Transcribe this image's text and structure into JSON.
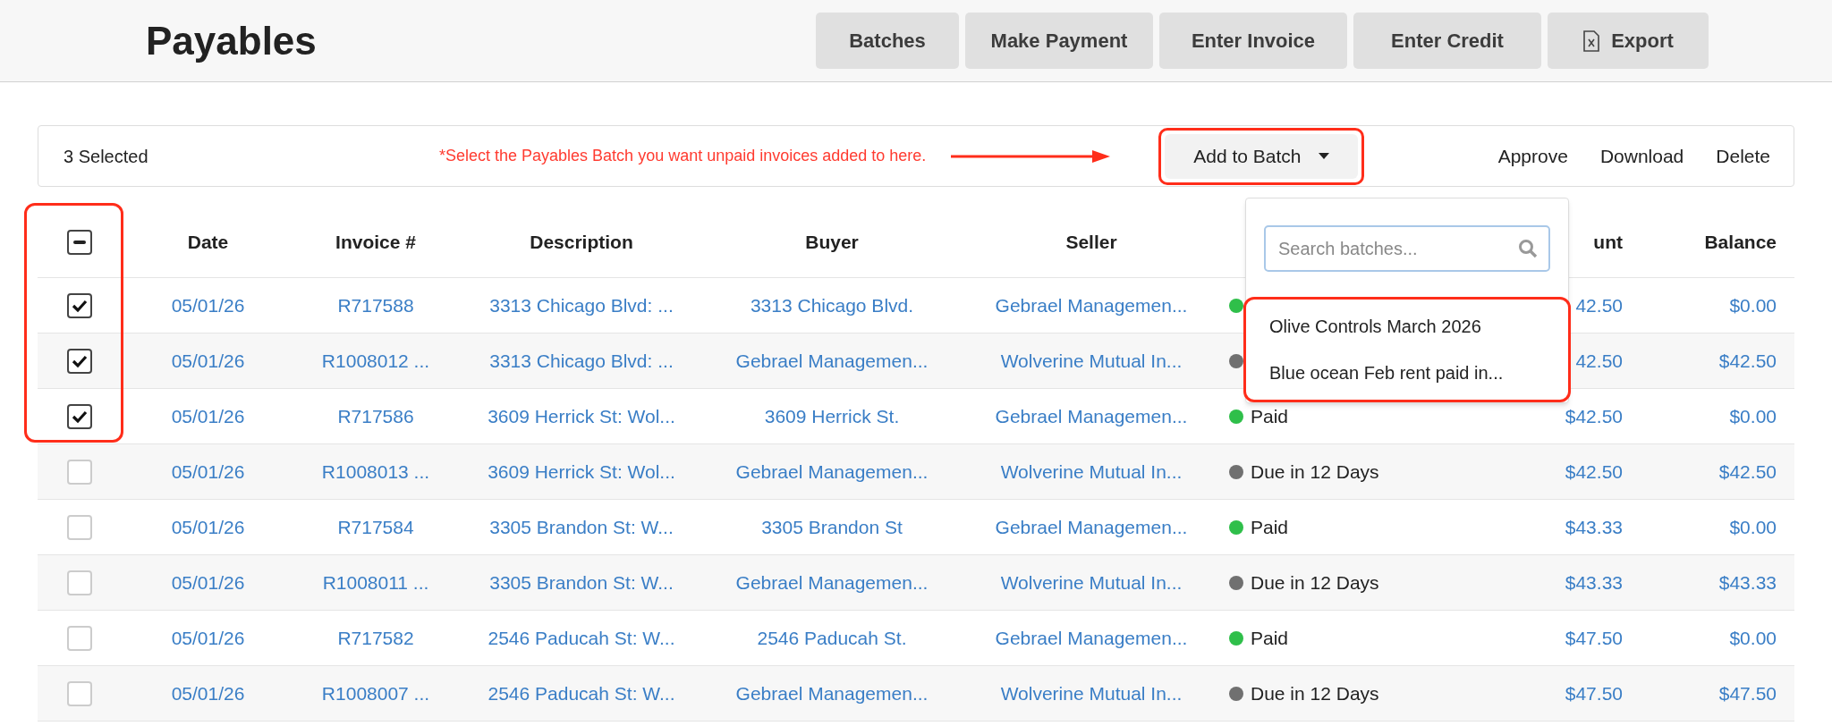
{
  "page_title": "Payables",
  "header_buttons": [
    {
      "label": "Batches",
      "kind": "plain"
    },
    {
      "label": "Make Payment",
      "kind": "plain"
    },
    {
      "label": "Enter Invoice",
      "kind": "plain"
    },
    {
      "label": "Enter Credit",
      "kind": "plain"
    },
    {
      "label": "Export",
      "kind": "file"
    }
  ],
  "toolbar": {
    "selected_count": "3 Selected",
    "note": "*Select the Payables Batch you want unpaid invoices added to here.",
    "batch_button": "Add to Batch",
    "actions": [
      "Approve",
      "Download",
      "Delete"
    ]
  },
  "batch_dropdown": {
    "placeholder": "Search batches...",
    "items": [
      "Olive Controls March 2026",
      "Blue ocean Feb rent paid in..."
    ]
  },
  "table": {
    "select_all": {
      "indeterminate": true
    },
    "columns": [
      "Date",
      "Invoice #",
      "Description",
      "Buyer",
      "Seller",
      "unt",
      "Balance"
    ],
    "rows": [
      {
        "checked": true,
        "date": "05/01/26",
        "invoice": "R717588",
        "description": "3313 Chicago Blvd: ...",
        "buyer": "3313 Chicago Blvd.",
        "seller": "Gebrael Managemen...",
        "color": "#2fbf4a",
        "amount": "42.50",
        "balance": "$0.00"
      },
      {
        "checked": true,
        "date": "05/01/26",
        "invoice": "R1008012 ...",
        "description": "3313 Chicago Blvd: ...",
        "buyer": "Gebrael Managemen...",
        "seller": "Wolverine Mutual In...",
        "color": "#707070",
        "amount": "42.50",
        "balance": "$42.50"
      },
      {
        "checked": true,
        "date": "05/01/26",
        "invoice": "R717586",
        "description": "3609 Herrick St: Wol...",
        "buyer": "3609 Herrick St.",
        "seller": "Gebrael Managemen...",
        "status": "Paid",
        "color": "#2fbf4a",
        "amount": "$42.50",
        "balance": "$0.00"
      },
      {
        "checked": false,
        "date": "05/01/26",
        "invoice": "R1008013 ...",
        "description": "3609 Herrick St: Wol...",
        "buyer": "Gebrael Managemen...",
        "seller": "Wolverine Mutual In...",
        "status": "Due in 12 Days",
        "color": "#707070",
        "amount": "$42.50",
        "balance": "$42.50"
      },
      {
        "checked": false,
        "date": "05/01/26",
        "invoice": "R717584",
        "description": "3305 Brandon St: W...",
        "buyer": "3305 Brandon St",
        "seller": "Gebrael Managemen...",
        "status": "Paid",
        "color": "#2fbf4a",
        "amount": "$43.33",
        "balance": "$0.00"
      },
      {
        "checked": false,
        "date": "05/01/26",
        "invoice": "R1008011 ...",
        "description": "3305 Brandon St: W...",
        "buyer": "Gebrael Managemen...",
        "seller": "Wolverine Mutual In...",
        "status": "Due in 12 Days",
        "color": "#707070",
        "amount": "$43.33",
        "balance": "$43.33"
      },
      {
        "checked": false,
        "date": "05/01/26",
        "invoice": "R717582",
        "description": "2546 Paducah St: W...",
        "buyer": "2546 Paducah St.",
        "seller": "Gebrael Managemen...",
        "status": "Paid",
        "color": "#2fbf4a",
        "amount": "$47.50",
        "balance": "$0.00"
      },
      {
        "checked": false,
        "date": "05/01/26",
        "invoice": "R1008007 ...",
        "description": "2546 Paducah St: W...",
        "buyer": "Gebrael Managemen...",
        "seller": "Wolverine Mutual In...",
        "status": "Due in 12 Days",
        "color": "#707070",
        "amount": "$47.50",
        "balance": "$47.50"
      }
    ]
  }
}
